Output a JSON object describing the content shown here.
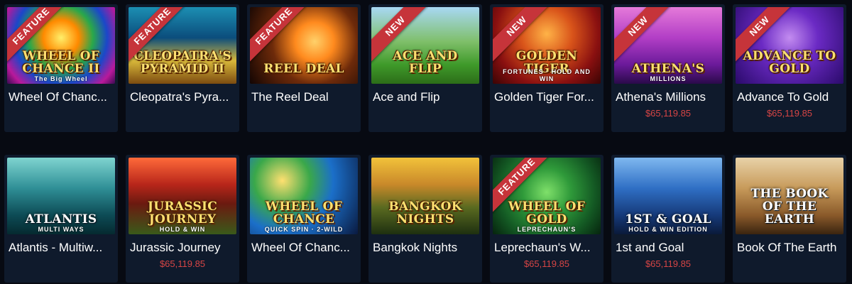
{
  "games": [
    {
      "name": "Wheel Of Chanc...",
      "art_title": "WHEEL OF CHANCE II",
      "art_sub": "The Big Wheel",
      "badge": "FEATURE",
      "jackpot": "",
      "art": "wheel1"
    },
    {
      "name": "Cleopatra's Pyra...",
      "art_title": "CLEOPATRA'S PYRAMID II",
      "art_sub": "",
      "badge": "FEATURE",
      "jackpot": "",
      "art": "cleo"
    },
    {
      "name": "The Reel Deal",
      "art_title": "REEL DEAL",
      "art_sub": "",
      "badge": "FEATURE",
      "jackpot": "",
      "art": "reel"
    },
    {
      "name": "Ace and Flip",
      "art_title": "ACE AND FLIP",
      "art_sub": "",
      "badge": "NEW",
      "jackpot": "",
      "art": "ace"
    },
    {
      "name": "Golden Tiger For...",
      "art_title": "GOLDEN TIGER",
      "art_sub": "FORTUNES · HOLD AND WIN",
      "badge": "NEW",
      "jackpot": "",
      "art": "tiger"
    },
    {
      "name": "Athena's Millions",
      "art_title": "ATHENA'S",
      "art_sub": "MILLIONS",
      "badge": "NEW",
      "jackpot": "$65,119.85",
      "art": "athena"
    },
    {
      "name": "Advance To Gold",
      "art_title": "ADVANCE TO GOLD",
      "art_sub": "",
      "badge": "NEW",
      "jackpot": "$65,119.85",
      "art": "advance"
    },
    {
      "name": "Atlantis - Multiw...",
      "art_title": "ATLANTIS",
      "art_sub": "MULTI WAYS",
      "badge": "",
      "jackpot": "",
      "art": "atlantis"
    },
    {
      "name": "Jurassic Journey",
      "art_title": "JURASSIC JOURNEY",
      "art_sub": "HOLD & WIN",
      "badge": "",
      "jackpot": "$65,119.85",
      "art": "jurassic"
    },
    {
      "name": "Wheel Of Chanc...",
      "art_title": "WHEEL OF CHANCE",
      "art_sub": "QUICK SPIN · 2-WILD",
      "badge": "",
      "jackpot": "",
      "art": "wheel2"
    },
    {
      "name": "Bangkok Nights",
      "art_title": "BANGKOK NIGHTS",
      "art_sub": "",
      "badge": "",
      "jackpot": "",
      "art": "bangkok"
    },
    {
      "name": "Leprechaun's W...",
      "art_title": "WHEEL OF GOLD",
      "art_sub": "LEPRECHAUN'S",
      "badge": "FEATURE",
      "jackpot": "$65,119.85",
      "art": "lep"
    },
    {
      "name": "1st and Goal",
      "art_title": "1ST & GOAL",
      "art_sub": "HOLD & WIN EDITION",
      "badge": "",
      "jackpot": "$65,119.85",
      "art": "goal"
    },
    {
      "name": "Book Of The Earth",
      "art_title": "THE BOOK OF THE EARTH",
      "art_sub": "",
      "badge": "",
      "jackpot": "",
      "art": "book"
    }
  ],
  "colors": {
    "background": "#070a12",
    "card": "#0f1a2c",
    "badge": "#c6343a",
    "jackpot": "#d64545",
    "name": "#ffffff"
  },
  "icons": {
    "badge_shape": "corner-ribbon"
  }
}
